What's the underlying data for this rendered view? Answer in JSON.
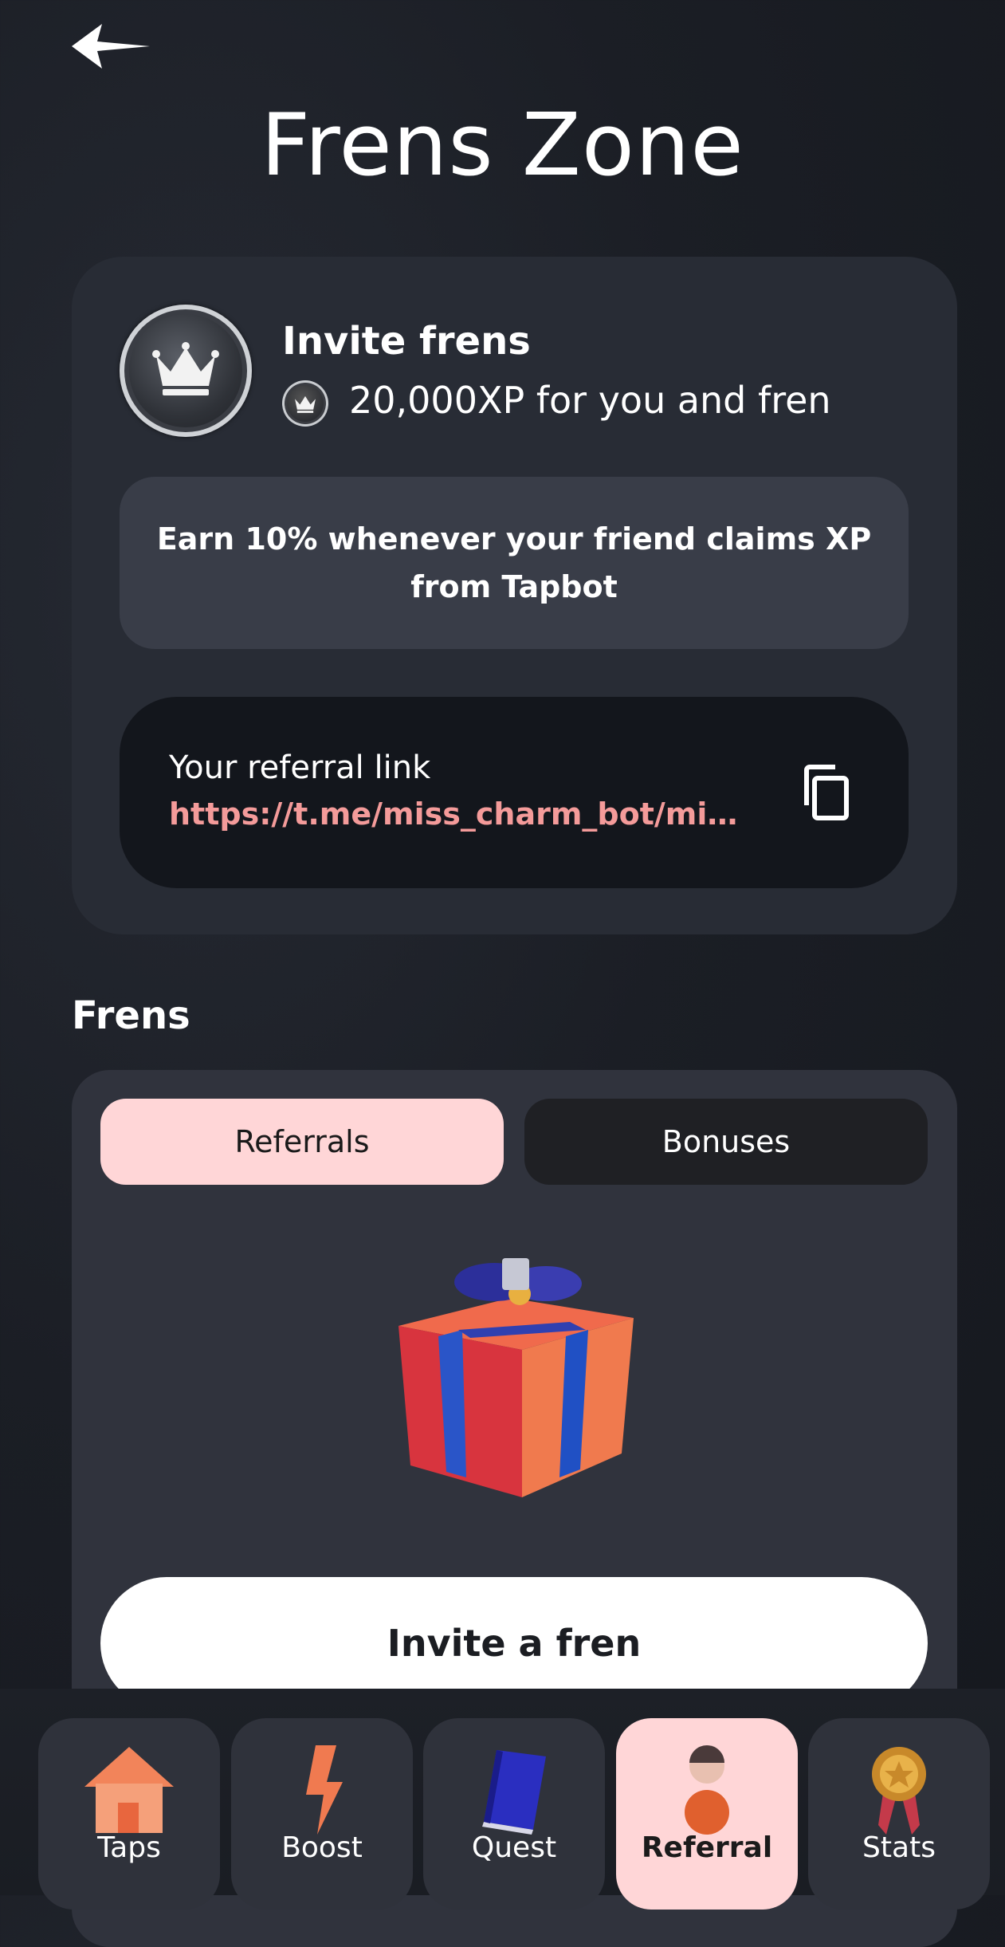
{
  "header": {
    "title": "Frens Zone",
    "back_icon": "back-arrow-icon"
  },
  "invite_card": {
    "title": "Invite frens",
    "reward": "20,000XP for you and fren",
    "earn_text": "Earn 10% whenever your friend claims XP from Tapbot",
    "referral_label": "Your referral link",
    "referral_link": "https://t.me/miss_charm_bot/missc...",
    "copy_icon": "copy-icon"
  },
  "frens": {
    "heading": "Frens",
    "tabs": [
      {
        "label": "Referrals",
        "active": true
      },
      {
        "label": "Bonuses",
        "active": false
      }
    ],
    "empty_icon": "gift-icon",
    "invite_button": "Invite a fren"
  },
  "nav": {
    "items": [
      {
        "label": "Taps",
        "icon": "house-icon",
        "active": false
      },
      {
        "label": "Boost",
        "icon": "lightning-icon",
        "active": false
      },
      {
        "label": "Quest",
        "icon": "book-icon",
        "active": false
      },
      {
        "label": "Referral",
        "icon": "person-icon",
        "active": true
      },
      {
        "label": "Stats",
        "icon": "medal-icon",
        "active": false
      }
    ]
  },
  "colors": {
    "accent_pink": "#ffd6d7",
    "link_color": "#f49b9a",
    "card_bg": "#282c35"
  }
}
